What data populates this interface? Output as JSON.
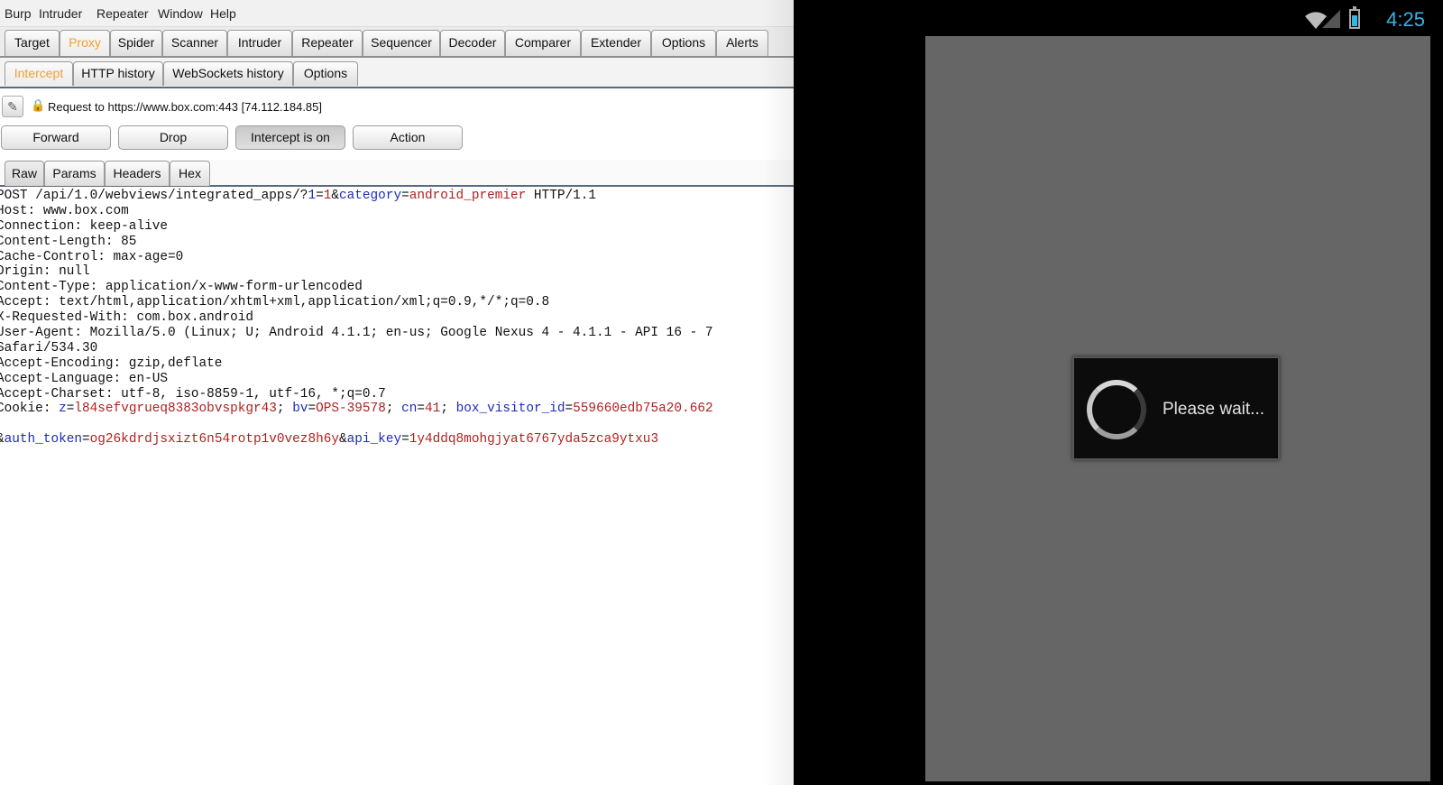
{
  "menubar": {
    "items": [
      "Burp",
      "Intruder",
      "Repeater",
      "Window",
      "Help"
    ]
  },
  "main_tabs": [
    "Target",
    "Proxy",
    "Spider",
    "Scanner",
    "Intruder",
    "Repeater",
    "Sequencer",
    "Decoder",
    "Comparer",
    "Extender",
    "Options",
    "Alerts"
  ],
  "main_tabs_active": "Proxy",
  "sub_tabs": [
    "Intercept",
    "HTTP history",
    "WebSockets history",
    "Options"
  ],
  "sub_tabs_active": "Intercept",
  "request_info": {
    "label": "Request to https://www.box.com:443  [74.112.184.85]",
    "edit_icon": "pencil-icon",
    "lock_icon": "lock-icon"
  },
  "actions": {
    "forward": "Forward",
    "drop": "Drop",
    "intercept": "Intercept is on",
    "action": "Action"
  },
  "view_tabs": [
    "Raw",
    "Params",
    "Headers",
    "Hex"
  ],
  "view_tabs_active": "Raw",
  "raw": {
    "request_method": "POST",
    "request_path": " /api/1.0/webviews/integrated_apps/?",
    "q1_name": "1",
    "q1_value": "1",
    "q2_name": "category",
    "q2_value": "android_premier",
    "request_version": " HTTP/1.1",
    "headers": [
      "Host: www.box.com",
      "Connection: keep-alive",
      "Content-Length: 85",
      "Cache-Control: max-age=0",
      "Origin: null",
      "Content-Type: application/x-www-form-urlencoded",
      "Accept: text/html,application/xhtml+xml,application/xml;q=0.9,*/*;q=0.8",
      "X-Requested-With: com.box.android",
      "User-Agent: Mozilla/5.0 (Linux; U; Android 4.1.1; en-us; Google Nexus 4 - 4.1.1 - API 16 - 7",
      "Safari/534.30",
      "Accept-Encoding: gzip,deflate",
      "Accept-Language: en-US",
      "Accept-Charset: utf-8, iso-8859-1, utf-16, *;q=0.7"
    ],
    "cookie_prefix": "Cookie: ",
    "cookies": [
      {
        "name": "z",
        "value": "l84sefvgrueq8383obvspkgr43"
      },
      {
        "name": "bv",
        "value": "OPS-39578"
      },
      {
        "name": "cn",
        "value": "41"
      },
      {
        "name": "box_visitor_id",
        "value": "559660edb75a20.662"
      }
    ],
    "body_params": [
      {
        "name": "auth_token",
        "value": "og26kdrdjsxizt6n54rotp1v0vez8h6y"
      },
      {
        "name": "api_key",
        "value": "1y4ddq8mohgjyat6767yda5zca9ytxu3"
      }
    ]
  },
  "emulator": {
    "clock": "4:25",
    "icons": [
      "wifi-icon",
      "signal-icon",
      "battery-icon"
    ],
    "dialog_text": "Please wait...",
    "spinner_icon": "spinner-icon",
    "accent_color": "#33b5e5",
    "screen_color": "#666666"
  },
  "colors": {
    "active_tab": "#f0a030",
    "param_name": "#1d2bb8",
    "param_value": "#b22020"
  }
}
